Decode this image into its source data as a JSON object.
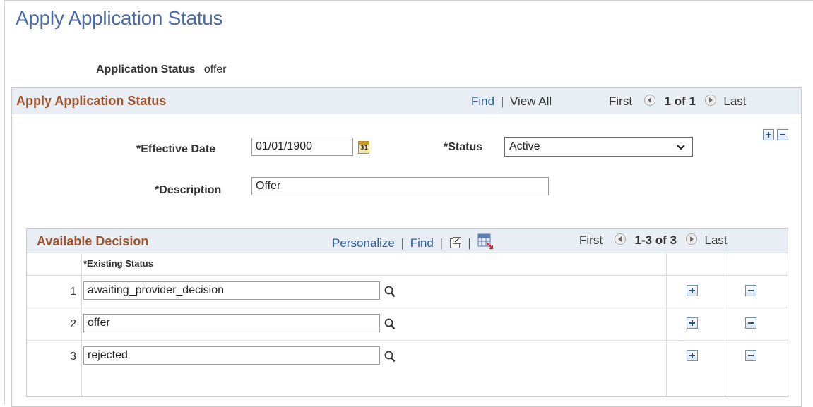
{
  "page": {
    "title": "Apply Application Status"
  },
  "app_status": {
    "label": "Application Status",
    "value": "offer"
  },
  "group": {
    "title": "Apply Application Status",
    "nav": {
      "find": "Find",
      "sep": "|",
      "view_all": "View All",
      "first": "First",
      "range": "1 of 1",
      "last": "Last"
    },
    "fields": {
      "effective_date": {
        "label": "*Effective Date",
        "value": "01/01/1900"
      },
      "status": {
        "label": "*Status",
        "value": "Active"
      },
      "description": {
        "label": "*Description",
        "value": "Offer"
      }
    }
  },
  "grid": {
    "title": "Available Decision",
    "nav": {
      "personalize": "Personalize",
      "find": "Find",
      "first": "First",
      "range": "1-3 of 3",
      "last": "Last"
    },
    "column_header": "*Existing Status",
    "rows": [
      {
        "num": "1",
        "value": "awaiting_provider_decision"
      },
      {
        "num": "2",
        "value": "offer"
      },
      {
        "num": "3",
        "value": "rejected"
      }
    ]
  },
  "icons": [
    "calendar-icon",
    "chevron-down-icon",
    "search-icon",
    "zoom-icon",
    "grid-download-icon",
    "add-row-icon",
    "delete-row-icon",
    "prev-icon",
    "next-icon"
  ],
  "colors": {
    "title": "#4a6aa5",
    "header_text": "#a1532b",
    "link": "#2a61a8",
    "header_bg": "#e9eef5"
  }
}
